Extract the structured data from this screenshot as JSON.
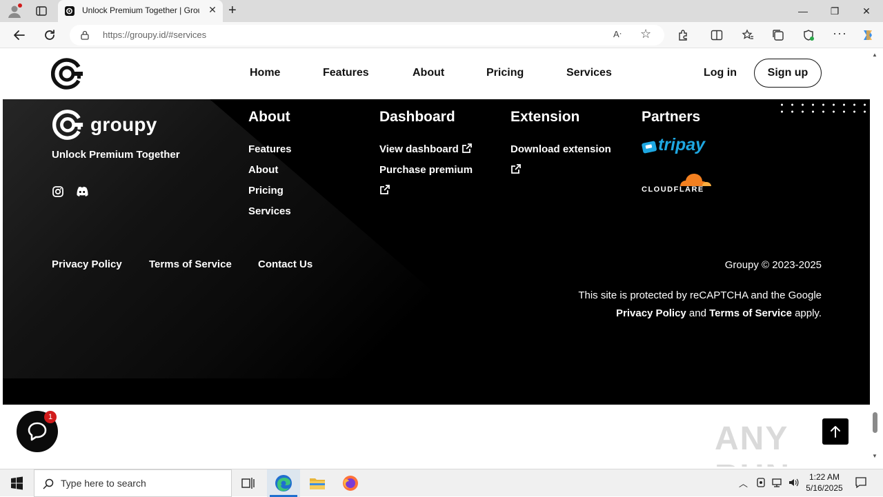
{
  "browser": {
    "tab_title": "Unlock Premium Together | Groupy",
    "url_host": "https://groupy.id/",
    "url_path": "#services"
  },
  "header": {
    "nav": [
      "Home",
      "Features",
      "About",
      "Pricing",
      "Services"
    ],
    "login": "Log in",
    "signup": "Sign up"
  },
  "footer": {
    "brand": "groupy",
    "tagline": "Unlock Premium Together",
    "columns": {
      "about": {
        "title": "About",
        "links": [
          "Features",
          "About",
          "Pricing",
          "Services"
        ]
      },
      "dashboard": {
        "title": "Dashboard",
        "links": [
          "View dashboard",
          "Purchase premium"
        ]
      },
      "extension": {
        "title": "Extension",
        "links": [
          "Download extension"
        ]
      },
      "partners": {
        "title": "Partners",
        "tripay": "tripay",
        "cloudflare": "CLOUDFLARE"
      }
    },
    "bottom_links": [
      "Privacy Policy",
      "Terms of Service",
      "Contact Us"
    ],
    "copyright": "Groupy © 2023-2025",
    "recaptcha": {
      "pre": "This site is protected by reCAPTCHA and the Google ",
      "privacy": "Privacy Policy",
      "and": " and ",
      "terms": "Terms of Service",
      "post": " apply."
    }
  },
  "chat": {
    "badge": "1"
  },
  "watermark": "ANY RUN",
  "taskbar": {
    "search_placeholder": "Type here to search",
    "time": "1:22 AM",
    "date": "5/16/2025"
  },
  "colors": {
    "tripay_blue": "#1ea7e1",
    "cloudflare_orange": "#f38020",
    "edge_blue": "#1f6fcf"
  }
}
